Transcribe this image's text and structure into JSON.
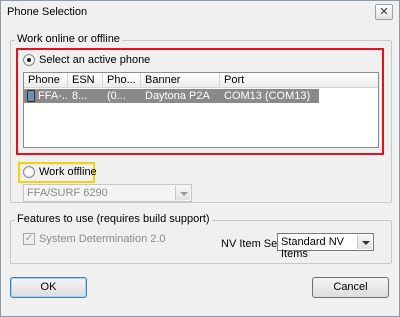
{
  "window": {
    "title": "Phone Selection",
    "close_glyph": "✕"
  },
  "online_group": {
    "label": "Work online or offline",
    "select_active_phone": "Select an active phone",
    "columns": [
      "Phone",
      "ESN",
      "Pho...",
      "Banner",
      "Port"
    ],
    "rows": [
      {
        "phone": "FFA-...",
        "esn": "8...",
        "pho": "(0...",
        "banner": "Daytona P2A",
        "port": "COM13 (COM13)"
      }
    ],
    "work_offline": "Work offline",
    "offline_model": "FFA/SURF 6290"
  },
  "features_group": {
    "label": "Features to use (requires build support)",
    "system_determination": "System Determination 2.0",
    "nv_item_set_label": "NV Item Set",
    "nv_item_set_value": "Standard NV Items"
  },
  "buttons": {
    "ok": "OK",
    "cancel": "Cancel"
  },
  "highlight_colors": {
    "active_phone_box": "#e8111a",
    "work_offline_box": "#f5d10a"
  }
}
